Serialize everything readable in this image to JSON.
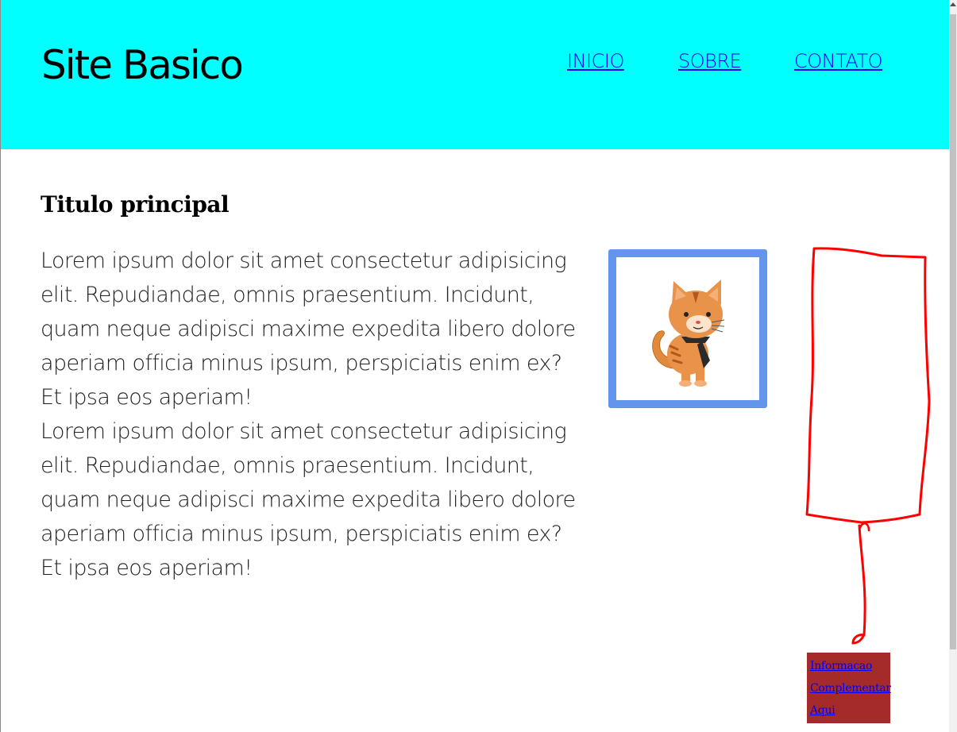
{
  "header": {
    "site_title": "Site Basico",
    "nav": [
      "INICIO",
      "SOBRE",
      "CONTATO"
    ]
  },
  "main": {
    "title": "Titulo principal",
    "paragraphs": [
      "Lorem ipsum dolor sit amet consectetur adipisicing elit. Repudiandae, omnis praesentium. Incidunt, quam neque adipisci maxime expedita libero dolore aperiam officia minus ipsum, perspiciatis enim ex? Et ipsa eos aperiam!",
      "Lorem ipsum dolor sit amet consectetur adipisicing elit. Repudiandae, omnis praesentium. Incidunt, quam neque adipisci maxime expedita libero dolore aperiam officia minus ipsum, perspiciatis enim ex? Et ipsa eos aperiam!"
    ],
    "image": {
      "icon": "cat-icon"
    }
  },
  "aside": {
    "links": [
      "Informacao",
      "Complementar",
      "Aqui"
    ]
  },
  "colors": {
    "header_bg": "#00ffff",
    "image_border": "#6495ed",
    "info_box_bg": "#a52a2a",
    "link": "#0000ee",
    "annotation": "#ff0000"
  }
}
